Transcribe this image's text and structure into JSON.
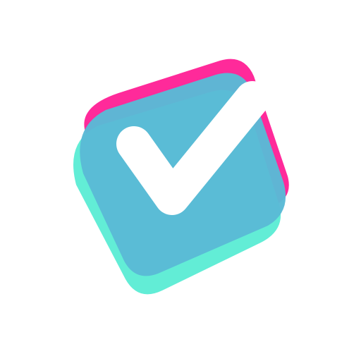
{
  "icon": {
    "name": "checkbox-check-icon",
    "colors": {
      "background": "#ffffff",
      "back_layer": "#FF2A9A",
      "front_layer": "#62EDD6",
      "middle_layer": "#5ABAD6",
      "check_mark": "#ffffff"
    }
  }
}
